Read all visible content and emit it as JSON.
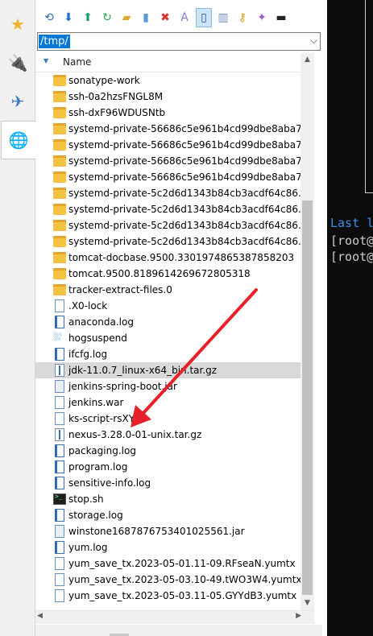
{
  "tabs": [
    {
      "icon": "star-icon",
      "glyph": "★",
      "color": "#f0b429"
    },
    {
      "icon": "plug-icon",
      "glyph": "🔌",
      "color": "#d9534f"
    },
    {
      "icon": "send-icon",
      "glyph": "✈",
      "color": "#3a78c4"
    },
    {
      "icon": "globe-icon",
      "glyph": "🌐",
      "color": "#e8760a"
    }
  ],
  "toolbar": [
    {
      "icon": "refresh-folder-icon",
      "glyph": "⟲",
      "color": "#2f6db5"
    },
    {
      "icon": "download-icon",
      "glyph": "⬇",
      "color": "#1f6fd1"
    },
    {
      "icon": "upload-icon",
      "glyph": "⬆",
      "color": "#18a06a"
    },
    {
      "icon": "reload-icon",
      "glyph": "↻",
      "color": "#2fa84f"
    },
    {
      "icon": "new-folder-icon",
      "glyph": "▰",
      "color": "#e0a82a"
    },
    {
      "icon": "new-file-icon",
      "glyph": "▮",
      "color": "#5b9bd5"
    },
    {
      "icon": "delete-icon",
      "glyph": "✖",
      "color": "#d9342b"
    },
    {
      "icon": "rename-icon",
      "glyph": "A",
      "color": "#8a7ad0"
    },
    {
      "icon": "properties-icon",
      "glyph": "▯",
      "color": "#2f4f8f"
    },
    {
      "icon": "filter-icon",
      "glyph": "▥",
      "color": "#6b8fb8"
    },
    {
      "icon": "key-icon",
      "glyph": "⚷",
      "color": "#d89a1a"
    },
    {
      "icon": "magic-wand-icon",
      "glyph": "✦",
      "color": "#9c5bd1"
    },
    {
      "icon": "terminal-icon",
      "glyph": "▬",
      "color": "#222222"
    }
  ],
  "path": "/tmp/",
  "column_header": "Name",
  "files": [
    {
      "name": "sonatype-work",
      "type": "folder"
    },
    {
      "name": "ssh-0a2hzsFNGL8M",
      "type": "folder"
    },
    {
      "name": "ssh-dxF96WDUSNtb",
      "type": "folder"
    },
    {
      "name": "systemd-private-56686c5e961b4cd99dbe8aba7...",
      "type": "folder"
    },
    {
      "name": "systemd-private-56686c5e961b4cd99dbe8aba7...",
      "type": "folder"
    },
    {
      "name": "systemd-private-56686c5e961b4cd99dbe8aba7...",
      "type": "folder"
    },
    {
      "name": "systemd-private-56686c5e961b4cd99dbe8aba7...",
      "type": "folder"
    },
    {
      "name": "systemd-private-5c2d6d1343b84cb3acdf64c86...",
      "type": "folder"
    },
    {
      "name": "systemd-private-5c2d6d1343b84cb3acdf64c86...",
      "type": "folder"
    },
    {
      "name": "systemd-private-5c2d6d1343b84cb3acdf64c86...",
      "type": "folder"
    },
    {
      "name": "systemd-private-5c2d6d1343b84cb3acdf64c86...",
      "type": "folder"
    },
    {
      "name": "tomcat-docbase.9500.3301974865387858203",
      "type": "folder"
    },
    {
      "name": "tomcat.9500.8189614269672805318",
      "type": "folder"
    },
    {
      "name": "tracker-extract-files.0",
      "type": "folder"
    },
    {
      "name": ".X0-lock",
      "type": "file"
    },
    {
      "name": "anaconda.log",
      "type": "log"
    },
    {
      "name": "hogsuspend",
      "type": "app"
    },
    {
      "name": "ifcfg.log",
      "type": "log"
    },
    {
      "name": "jdk-11.0.7_linux-x64_bin.tar.gz",
      "type": "gz",
      "selected": true
    },
    {
      "name": "jenkins-spring-boot.jar",
      "type": "jar"
    },
    {
      "name": "jenkins.war",
      "type": "file"
    },
    {
      "name": "ks-script-rsXYJ",
      "type": "file"
    },
    {
      "name": "nexus-3.28.0-01-unix.tar.gz",
      "type": "gz"
    },
    {
      "name": "packaging.log",
      "type": "log"
    },
    {
      "name": "program.log",
      "type": "log"
    },
    {
      "name": "sensitive-info.log",
      "type": "log"
    },
    {
      "name": "stop.sh",
      "type": "sh"
    },
    {
      "name": "storage.log",
      "type": "log"
    },
    {
      "name": "winstone1687876753401025561.jar",
      "type": "jar"
    },
    {
      "name": "yum.log",
      "type": "log"
    },
    {
      "name": "yum_save_tx.2023-05-01.11-09.RFseaN.yumtx",
      "type": "file"
    },
    {
      "name": "yum_save_tx.2023-05-03.10-49.tWO3W4.yumtx",
      "type": "file"
    },
    {
      "name": "yum_save_tx.2023-05-03.11-05.GYYdB3.yumtx",
      "type": "file"
    }
  ],
  "terminal": {
    "last_line": "Last l",
    "prompt1": "[root@",
    "prompt2": "[root@"
  },
  "colors": {
    "selection": "#0078d7",
    "annotation_arrow": "#e8202a",
    "terminal_bg": "#0c0c0c",
    "terminal_last": "#3b8eea"
  }
}
